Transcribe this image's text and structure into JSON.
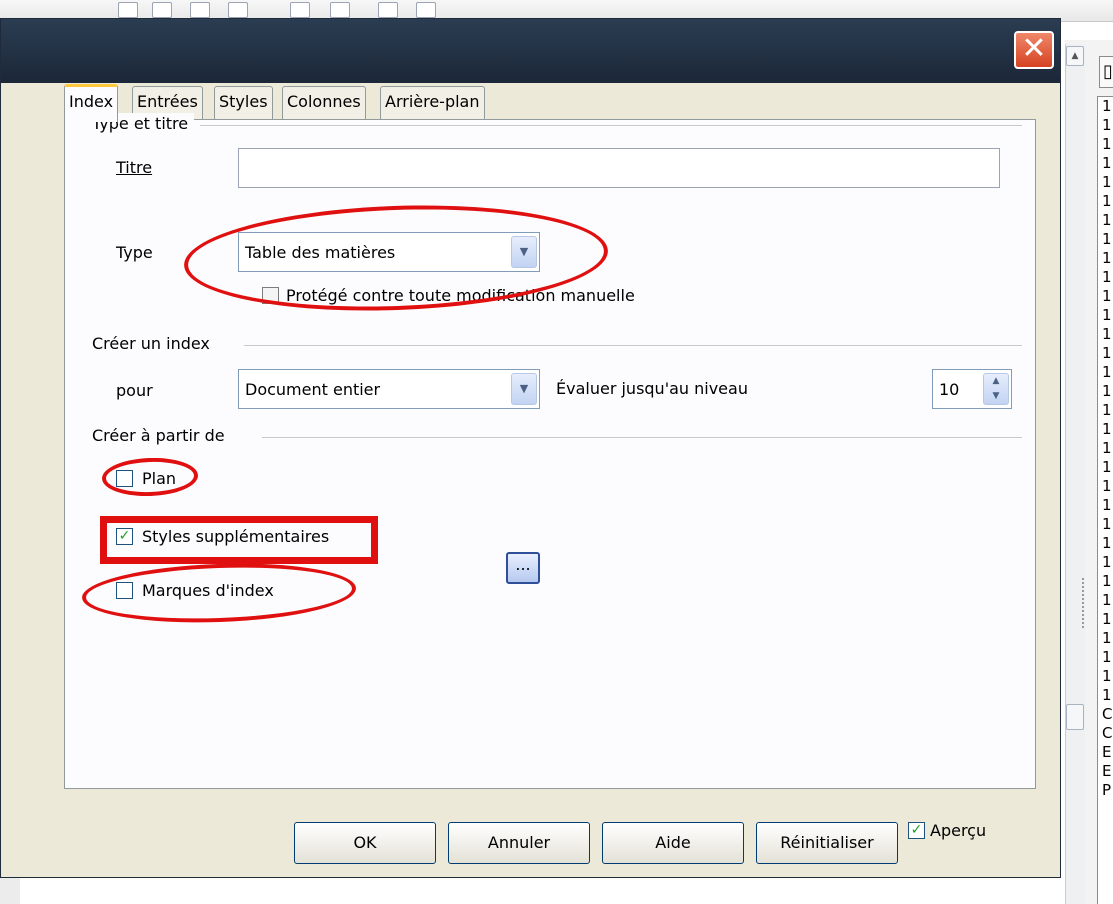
{
  "dialog": {
    "close_icon": "close-icon",
    "tabs": [
      {
        "label": "Index",
        "active": true
      },
      {
        "label": "Entrées",
        "active": false
      },
      {
        "label": "Styles",
        "active": false
      },
      {
        "label": "Colonnes",
        "active": false
      },
      {
        "label": "Arrière-plan",
        "active": false
      }
    ],
    "type_section": {
      "header": "Type et titre",
      "titre_label": "Titre",
      "titre_value": "",
      "type_label": "Type",
      "type_value": "Table des matières",
      "protege_label": "Protégé contre toute modification manuelle",
      "protege_checked": false
    },
    "index_section": {
      "header": "Créer un index",
      "pour_label": "pour",
      "pour_value": "Document entier",
      "evaluer_label": "Évaluer jusqu'au niveau",
      "niveau_value": "10"
    },
    "source_section": {
      "header": "Créer à partir de",
      "plan_label": "Plan",
      "plan_checked": false,
      "styles_label": "Styles supplémentaires",
      "styles_checked": true,
      "browse_label": "...",
      "marques_label": "Marques d'index",
      "marques_checked": false
    },
    "buttons": {
      "ok": "OK",
      "annuler": "Annuler",
      "aide": "Aide",
      "reinitialiser": "Réinitialiser",
      "apercu_label": "Aperçu",
      "apercu_checked": true
    }
  },
  "background": {
    "list_items": [
      "1",
      "1",
      "1",
      "1",
      "1",
      "1",
      "1",
      "1",
      "1",
      "1",
      "1",
      "1",
      "1",
      "1",
      "1",
      "1",
      "1",
      "1",
      "1",
      "1",
      "1",
      "1",
      "1",
      "1",
      "1",
      "1",
      "1",
      "1",
      "1",
      "1",
      "1",
      "1",
      "C",
      "C",
      "E",
      "E",
      "P"
    ]
  },
  "colors": {
    "titlebar": "#1f2d40",
    "close": "#e0532f",
    "dialog_bg": "#ece9d8",
    "annotation": "#e01010",
    "check": "#21a121"
  }
}
